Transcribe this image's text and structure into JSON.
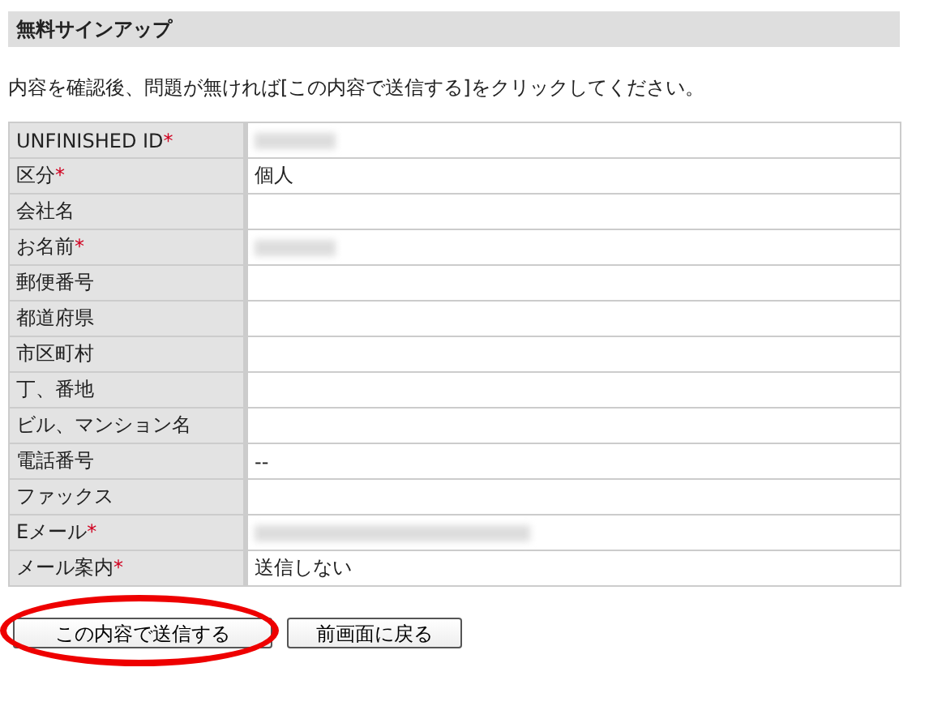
{
  "heading": "無料サインアップ",
  "instruction": "内容を確認後、問題が無ければ[この内容で送信する]をクリックしてください。",
  "rows": [
    {
      "label": "UNFINISHED ID",
      "required": true,
      "kind": "blurred"
    },
    {
      "label": "区分",
      "required": true,
      "kind": "text",
      "value": "個人"
    },
    {
      "label": "会社名",
      "required": false,
      "kind": "empty"
    },
    {
      "label": "お名前",
      "required": true,
      "kind": "blurred"
    },
    {
      "label": "郵便番号",
      "required": false,
      "kind": "empty"
    },
    {
      "label": "都道府県",
      "required": false,
      "kind": "empty"
    },
    {
      "label": "市区町村",
      "required": false,
      "kind": "empty"
    },
    {
      "label": "丁、番地",
      "required": false,
      "kind": "empty"
    },
    {
      "label": "ビル、マンション名",
      "required": false,
      "kind": "empty"
    },
    {
      "label": "電話番号",
      "required": false,
      "kind": "text",
      "value": "--"
    },
    {
      "label": "ファックス",
      "required": false,
      "kind": "empty"
    },
    {
      "label": "Eメール",
      "required": true,
      "kind": "blurred"
    },
    {
      "label": "メール案内",
      "required": true,
      "kind": "text",
      "value": "送信しない"
    }
  ],
  "required_mark": "*",
  "buttons": [
    {
      "label": "この内容で送信する",
      "highlighted": true
    },
    {
      "label": "前画面に戻る",
      "highlighted": false
    }
  ]
}
